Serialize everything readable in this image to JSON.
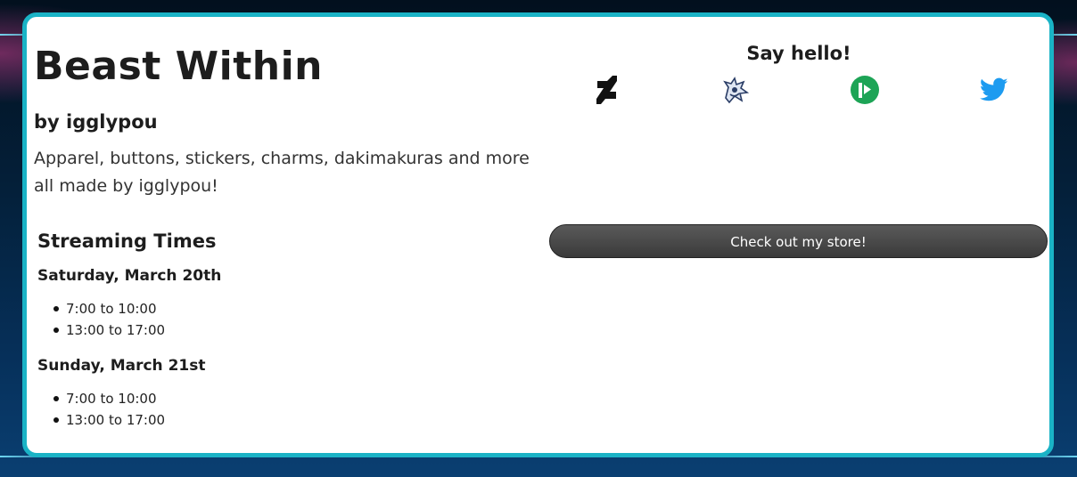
{
  "header": {
    "title": "Beast Within",
    "byline": "by igglypou",
    "description": "Apparel, buttons, stickers, charms, dakimakuras and more all made by igglypou!"
  },
  "streaming": {
    "title": "Streaming Times",
    "days": [
      {
        "label": "Saturday, March 20th",
        "times": [
          "7:00 to 10:00",
          "13:00 to 17:00"
        ]
      },
      {
        "label": "Sunday, March 21st",
        "times": [
          "7:00 to 10:00",
          "13:00 to 17:00"
        ]
      }
    ]
  },
  "social": {
    "heading": "Say hello!",
    "links": [
      {
        "icon": "deviantart-icon",
        "color": "#111111"
      },
      {
        "icon": "fursona-avatar-icon",
        "color": "#2a3d66"
      },
      {
        "icon": "picarto-icon",
        "color": "#1da456"
      },
      {
        "icon": "twitter-icon",
        "color": "#1d9bf0"
      }
    ]
  },
  "store": {
    "button_label": "Check out my store!"
  },
  "colors": {
    "card_border": "#1ab3c6",
    "button_bg": "#474747"
  }
}
